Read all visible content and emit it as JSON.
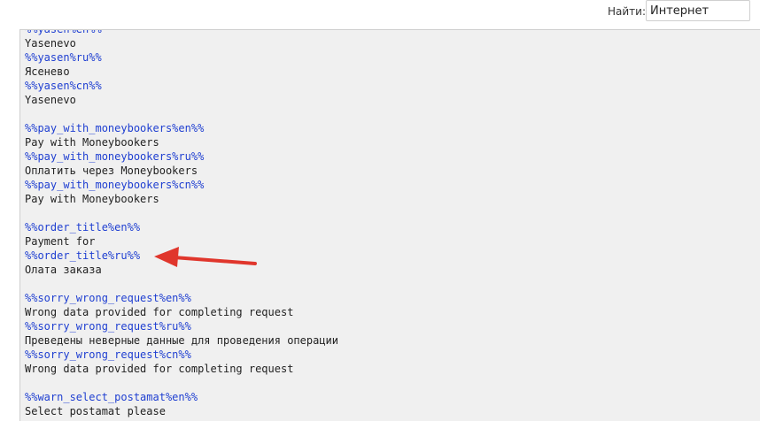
{
  "search": {
    "label": "Найти:",
    "value": "Интернет"
  },
  "editor": {
    "lines": [
      {
        "type": "key",
        "text": "%%yasen%en%%"
      },
      {
        "type": "val",
        "text": "Yasenevo"
      },
      {
        "type": "key",
        "text": "%%yasen%ru%%"
      },
      {
        "type": "val",
        "text": "Ясенево"
      },
      {
        "type": "key",
        "text": "%%yasen%cn%%"
      },
      {
        "type": "val",
        "text": "Yasenevo"
      },
      {
        "type": "blank",
        "text": ""
      },
      {
        "type": "key",
        "text": "%%pay_with_moneybookers%en%%"
      },
      {
        "type": "val",
        "text": "Pay with Moneybookers"
      },
      {
        "type": "key",
        "text": "%%pay_with_moneybookers%ru%%"
      },
      {
        "type": "val",
        "text": "Оплатить через Moneybookers"
      },
      {
        "type": "key",
        "text": "%%pay_with_moneybookers%cn%%"
      },
      {
        "type": "val",
        "text": "Pay with Moneybookers"
      },
      {
        "type": "blank",
        "text": ""
      },
      {
        "type": "key",
        "text": "%%order_title%en%%"
      },
      {
        "type": "val",
        "text": "Payment for"
      },
      {
        "type": "key",
        "text": "%%order_title%ru%%"
      },
      {
        "type": "val",
        "text": "Олата заказа"
      },
      {
        "type": "blank",
        "text": ""
      },
      {
        "type": "key",
        "text": "%%sorry_wrong_request%en%%"
      },
      {
        "type": "val",
        "text": "Wrong data provided for completing request"
      },
      {
        "type": "key",
        "text": "%%sorry_wrong_request%ru%%"
      },
      {
        "type": "val",
        "text": "Преведены неверные данные для проведения операции"
      },
      {
        "type": "key",
        "text": "%%sorry_wrong_request%cn%%"
      },
      {
        "type": "val",
        "text": "Wrong data provided for completing request"
      },
      {
        "type": "blank",
        "text": ""
      },
      {
        "type": "key",
        "text": "%%warn_select_postamat%en%%"
      },
      {
        "type": "val",
        "text": "Select postamat please"
      }
    ]
  },
  "colors": {
    "key_text": "#1f3fd1",
    "value_text": "#222222",
    "editor_background": "#f0f0f0",
    "annotation_arrow": "#e0362c"
  },
  "annotation": {
    "icon": "arrow-left-icon"
  }
}
